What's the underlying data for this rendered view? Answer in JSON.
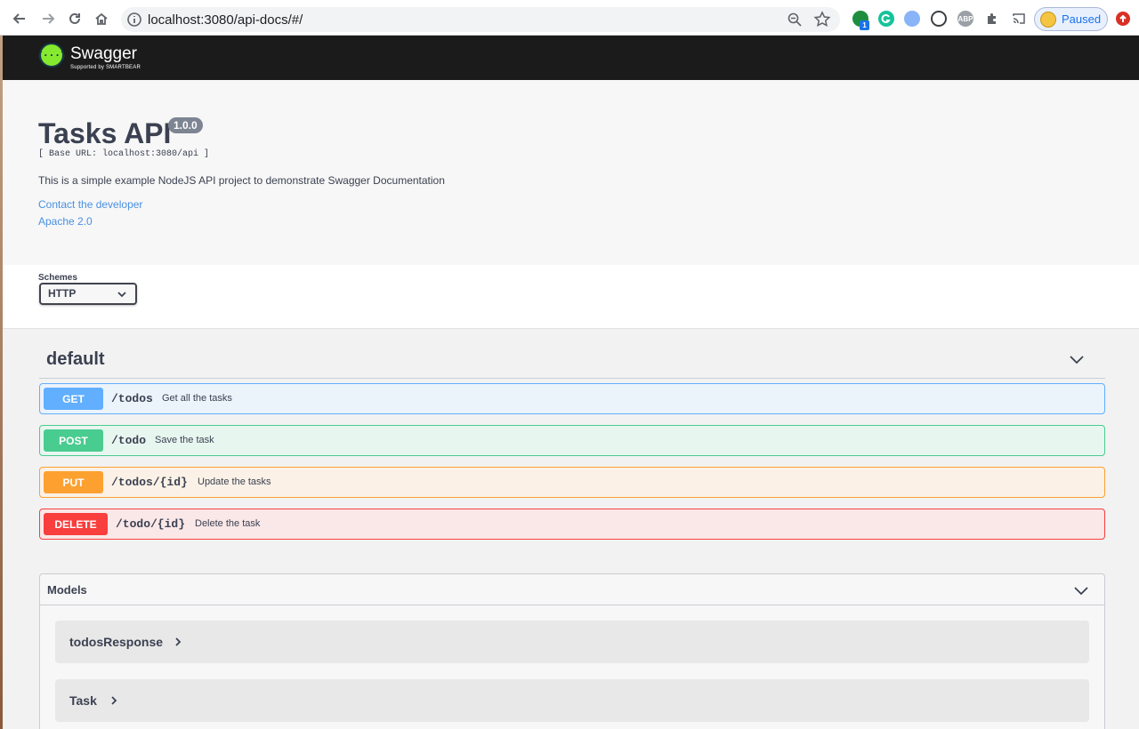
{
  "browser": {
    "url": "localhost:3080/api-docs/#/",
    "extension_badge": "1",
    "abp_label": "ABP",
    "profile_status": "Paused"
  },
  "swagger": {
    "brand": "Swagger",
    "brand_sub": "Supported by SMARTBEAR",
    "logo_glyph": "{···}"
  },
  "info": {
    "title": "Tasks API",
    "version": "1.0.0",
    "base_url": "[ Base URL: localhost:3080/api ]",
    "description": "This is a simple example NodeJS API project to demonstrate Swagger Documentation",
    "contact_link": "Contact the developer",
    "license_link": "Apache 2.0"
  },
  "schemes": {
    "label": "Schemes",
    "selected": "HTTP"
  },
  "section": {
    "title": "default",
    "operations": [
      {
        "method": "GET",
        "path": "/todos",
        "summary": "Get all the tasks"
      },
      {
        "method": "POST",
        "path": "/todo",
        "summary": "Save the task"
      },
      {
        "method": "PUT",
        "path": "/todos/{id}",
        "summary": "Update the tasks"
      },
      {
        "method": "DELETE",
        "path": "/todo/{id}",
        "summary": "Delete the task"
      }
    ]
  },
  "models": {
    "title": "Models",
    "items": [
      {
        "name": "todosResponse"
      },
      {
        "name": "Task"
      }
    ]
  },
  "colors": {
    "get": "#61affe",
    "post": "#49cc90",
    "put": "#fca130",
    "delete": "#f93e3e"
  }
}
